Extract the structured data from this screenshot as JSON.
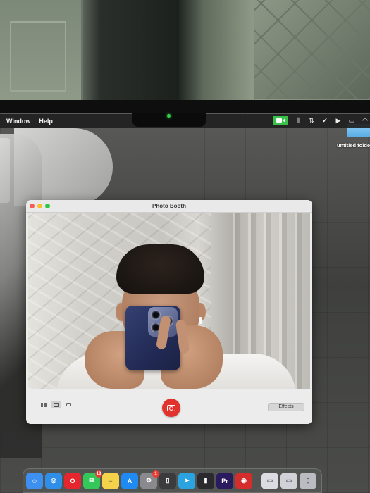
{
  "menubar": {
    "items": [
      "Window",
      "Help"
    ],
    "status_icons": [
      "facetime-camera-indicator",
      "sliders-icon",
      "airplay-icon",
      "check-icon",
      "play-icon",
      "bed-icon",
      "wifi-icon"
    ]
  },
  "desktop": {
    "folder_label": "untitled folder"
  },
  "window": {
    "title": "Photo Booth",
    "effects_label": "Effects",
    "view_modes": [
      "grid-view-icon",
      "photo-view-icon",
      "video-view-icon"
    ],
    "active_view": "photo-view-icon"
  },
  "dock": {
    "apps": [
      {
        "name": "finder",
        "glyph": "☺",
        "color": "#3d8ff0"
      },
      {
        "name": "safari",
        "glyph": "◎",
        "color": "#2f8fe8"
      },
      {
        "name": "opera",
        "glyph": "O",
        "color": "#e6262f"
      },
      {
        "name": "messages",
        "glyph": "✉",
        "color": "#34c759",
        "badge": "18"
      },
      {
        "name": "notes",
        "glyph": "≡",
        "color": "#f4d24a"
      },
      {
        "name": "app-store",
        "glyph": "A",
        "color": "#1f8bf2"
      },
      {
        "name": "system-settings",
        "glyph": "⚙",
        "color": "#8a8a8e",
        "badge": "1"
      },
      {
        "name": "iphone-mirroring",
        "glyph": "▯",
        "color": "#3b3b3e"
      },
      {
        "name": "telegram",
        "glyph": "➤",
        "color": "#2aa3e0"
      },
      {
        "name": "final-cut",
        "glyph": "▮",
        "color": "#2b2b2f"
      },
      {
        "name": "premiere-pro",
        "glyph": "Pr",
        "color": "#2a1b5e"
      },
      {
        "name": "photo-booth",
        "glyph": "◉",
        "color": "#d52c2c"
      },
      {
        "name": "preview-window",
        "glyph": "▭",
        "color": "#d9dce0"
      },
      {
        "name": "mail-window",
        "glyph": "▭",
        "color": "#cfd3d8"
      },
      {
        "name": "trash",
        "glyph": "▯",
        "color": "#b9bcc0"
      }
    ]
  }
}
